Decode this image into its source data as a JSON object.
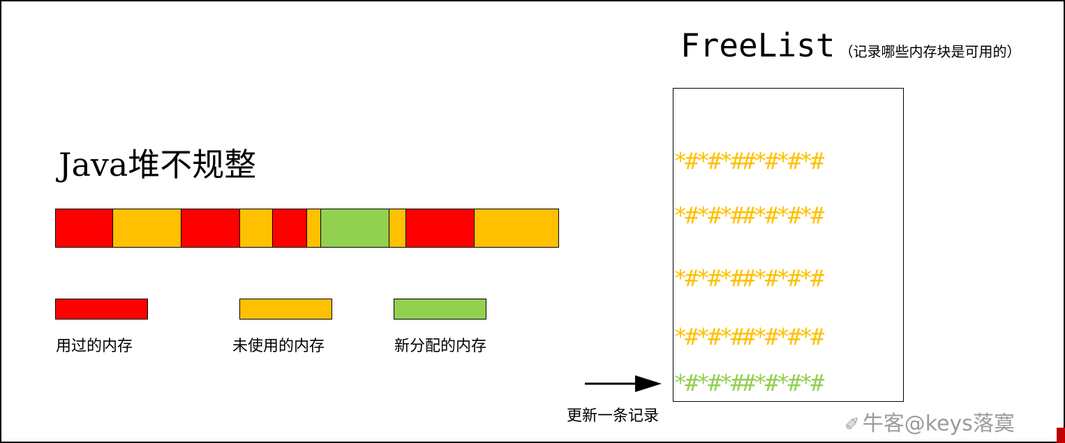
{
  "heap": {
    "title": "Java堆不规整",
    "segments": [
      {
        "type": "used",
        "color": "#ff0000"
      },
      {
        "type": "unused",
        "color": "#ffc000"
      },
      {
        "type": "used",
        "color": "#ff0000"
      },
      {
        "type": "unused",
        "color": "#ffc000"
      },
      {
        "type": "used",
        "color": "#ff0000"
      },
      {
        "type": "unused",
        "color": "#ffc000"
      },
      {
        "type": "new",
        "color": "#92d050"
      },
      {
        "type": "unused",
        "color": "#ffc000"
      },
      {
        "type": "used",
        "color": "#ff0000"
      },
      {
        "type": "unused",
        "color": "#ffc000"
      }
    ]
  },
  "legend": {
    "used_label": "用过的内存",
    "unused_label": "未使用的内存",
    "new_label": "新分配的内存",
    "used_color": "#ff0000",
    "unused_color": "#ffc000",
    "new_color": "#92d050"
  },
  "freelist": {
    "title": "FreeList",
    "subtitle": "（记录哪些内存块是可用的）",
    "rows": [
      {
        "text": "*#*#*##*#*#*#",
        "color": "#ffc000"
      },
      {
        "text": "*#*#*##*#*#*#",
        "color": "#ffc000"
      },
      {
        "text": "*#*#*##*#*#*#",
        "color": "#ffc000"
      },
      {
        "text": "*#*#*##*#*#*#",
        "color": "#ffc000"
      },
      {
        "text": "*#*#*##*#*#*#",
        "color": "#92d050"
      }
    ]
  },
  "arrow": {
    "label": "更新一条记录"
  },
  "watermark": {
    "text": "牛客@keys落寞"
  }
}
